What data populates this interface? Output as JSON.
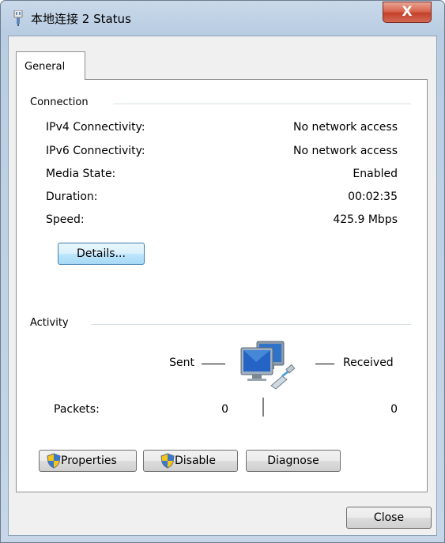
{
  "window": {
    "title": "本地连接 2 Status",
    "close_glyph": "X"
  },
  "tabs": [
    {
      "label": "General",
      "selected": true
    }
  ],
  "connection": {
    "heading": "Connection",
    "rows": [
      {
        "label": "IPv4 Connectivity:",
        "value": "No network access"
      },
      {
        "label": "IPv6 Connectivity:",
        "value": "No network access"
      },
      {
        "label": "Media State:",
        "value": "Enabled"
      },
      {
        "label": "Duration:",
        "value": "00:02:35"
      },
      {
        "label": "Speed:",
        "value": "425.9 Mbps"
      }
    ],
    "details_button": "Details..."
  },
  "activity": {
    "heading": "Activity",
    "sent_label": "Sent",
    "received_label": "Received",
    "packets_label": "Packets:",
    "packets_sent": "0",
    "packets_received": "0",
    "icon": "network-computers-icon"
  },
  "buttons": {
    "properties": "Properties",
    "disable": "Disable",
    "diagnose": "Diagnose",
    "close": "Close"
  },
  "colors": {
    "window_frame": "#b9cde2",
    "close_button": "#c5412b",
    "focus_border": "#3c7fb1"
  }
}
